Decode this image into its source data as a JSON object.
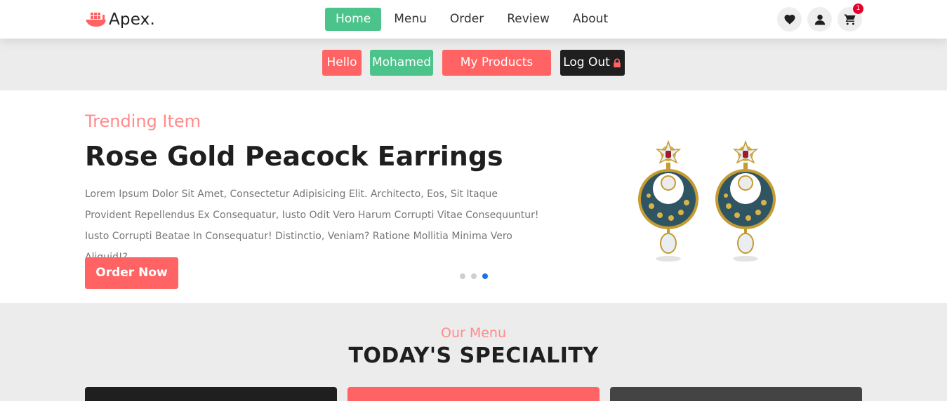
{
  "header": {
    "logo_text": "Apex.",
    "nav": [
      {
        "label": "Home",
        "active": true
      },
      {
        "label": "Menu",
        "active": false
      },
      {
        "label": "Order",
        "active": false
      },
      {
        "label": "Review",
        "active": false
      },
      {
        "label": "About",
        "active": false
      }
    ],
    "icons": [
      "heart-icon",
      "user-icon",
      "cart-icon"
    ],
    "cart_count": "1"
  },
  "userbar": {
    "hello": "Hello",
    "username": "Mohamed",
    "products": "My Products",
    "logout": "Log Out"
  },
  "hero": {
    "subtitle": "Trending Item",
    "title": "Rose Gold Peacock Earrings",
    "description": "Lorem Ipsum Dolor Sit Amet, Consectetur Adipisicing Elit. Architecto, Eos, Sit Itaque Provident Repellendus Ex Consequatur, Iusto Odit Vero Harum Corrupti Vitae Consequuntur! Iusto Corrupti Beatae In Consequatur! Distinctio, Veniam? Ratione Mollitia Minima Vero Aliquid!?",
    "order_button": "Order Now",
    "slides": 3,
    "active_slide": 3
  },
  "menu_section": {
    "subtitle": "Our Menu",
    "title": "TODAY'S SPECIALITY"
  },
  "colors": {
    "accent_green": "#4cc38a",
    "accent_red": "#ff6363",
    "dark": "#1f1f1f",
    "pink_text": "#ff8b8b"
  }
}
